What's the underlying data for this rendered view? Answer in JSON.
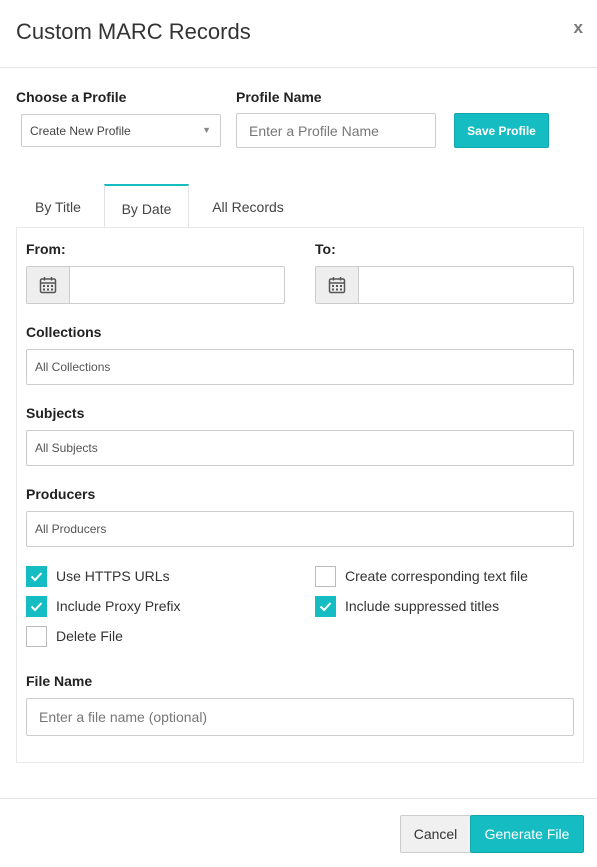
{
  "dialog": {
    "title": "Custom MARC Records",
    "close_label": "x"
  },
  "profile": {
    "choose_label": "Choose a Profile",
    "selected": "Create New Profile",
    "name_label": "Profile Name",
    "name_placeholder": "Enter a Profile Name",
    "save_label": "Save Profile"
  },
  "tabs": [
    {
      "label": "By Title",
      "active": false
    },
    {
      "label": "By Date",
      "active": true
    },
    {
      "label": "All Records",
      "active": false
    }
  ],
  "dates": {
    "from_label": "From:",
    "to_label": "To:"
  },
  "filters": {
    "collections_label": "Collections",
    "collections_value": "All Collections",
    "subjects_label": "Subjects",
    "subjects_value": "All Subjects",
    "producers_label": "Producers",
    "producers_value": "All Producers"
  },
  "options": {
    "https_urls": {
      "label": "Use HTTPS URLs",
      "checked": true
    },
    "text_file": {
      "label": "Create corresponding text file",
      "checked": false
    },
    "proxy_prefix": {
      "label": "Include Proxy Prefix",
      "checked": true
    },
    "suppressed": {
      "label": "Include suppressed titles",
      "checked": true
    },
    "delete_file": {
      "label": "Delete File",
      "checked": false
    }
  },
  "file": {
    "label": "File Name",
    "placeholder": "Enter a file name (optional)"
  },
  "footer": {
    "cancel_label": "Cancel",
    "generate_label": "Generate File"
  },
  "icons": {
    "calendar": "calendar-icon",
    "check": "check-icon",
    "caret": "caret-down-icon"
  },
  "colors": {
    "accent": "#15bcc2"
  }
}
